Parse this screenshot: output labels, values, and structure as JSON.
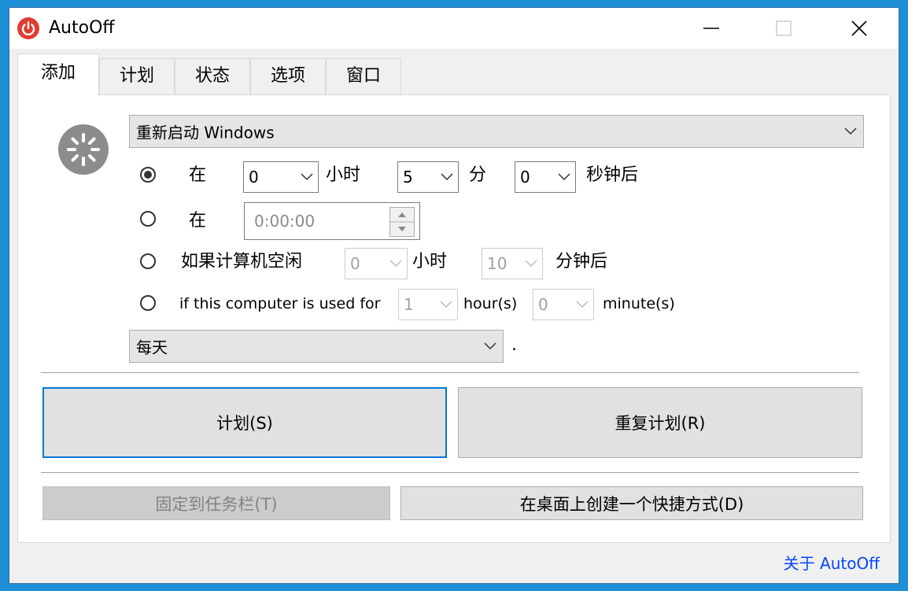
{
  "window": {
    "title": "AutoOff",
    "accent": "#e03c31"
  },
  "tabs": [
    {
      "label": "添加"
    },
    {
      "label": "计划"
    },
    {
      "label": "状态"
    },
    {
      "label": "选项"
    },
    {
      "label": "窗口"
    }
  ],
  "action": {
    "selected": "重新启动 Windows"
  },
  "options": {
    "in_label": "在",
    "hours_value": "0",
    "hours_unit": "小时",
    "minutes_value": "5",
    "minutes_unit": "分",
    "seconds_value": "0",
    "seconds_unit": "秒钟后",
    "at_label": "在",
    "time_value": "0:00:00",
    "idle_label": "如果计算机空闲",
    "idle_hours_value": "0",
    "idle_hours_unit": "小时",
    "idle_minutes_value": "10",
    "idle_minutes_unit": "分钟后",
    "used_label": "if this computer is used for",
    "used_hours_value": "1",
    "used_hours_unit": "hour(s)",
    "used_minutes_value": "0",
    "used_minutes_unit": "minute(s)"
  },
  "repeat": {
    "selected": "每天",
    "suffix": "."
  },
  "buttons": {
    "schedule": "计划(S)",
    "repeat_schedule": "重复计划(R)",
    "pin_taskbar": "固定到任务栏(T)",
    "create_shortcut": "在桌面上创建一个快捷方式(D)"
  },
  "footer": {
    "about": "关于 AutoOff"
  }
}
